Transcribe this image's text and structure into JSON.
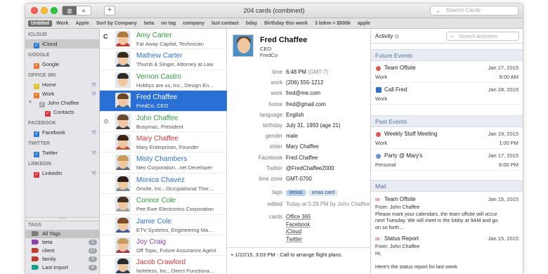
{
  "toolbar": {
    "title": "204 cards (combined)",
    "add_label": "+",
    "search_placeholder": "Search Cards"
  },
  "tagbar": [
    "Untitled",
    "Work",
    "Apple",
    "Sort by Company",
    "beta",
    "no tag",
    "company",
    "last contact",
    "bday",
    "Birthday this week",
    "3 bdrm < $500k",
    "apple"
  ],
  "sidebar": {
    "groups": [
      {
        "header": "ICLOUD",
        "items": [
          {
            "label": "iCloud",
            "color": "#2e7bd6",
            "selected": true
          }
        ]
      },
      {
        "header": "GOOGLE",
        "items": [
          {
            "label": "Google",
            "color": "#e9762b"
          }
        ]
      },
      {
        "header": "OFFICE 365",
        "items": [
          {
            "label": "Home",
            "color": "#e0c02a"
          },
          {
            "label": "Work",
            "color": "#e9762b"
          },
          {
            "label": "John Chaffee",
            "color": "#aaaaaa"
          },
          {
            "label": "Contacts",
            "color": "#d8353b"
          }
        ]
      },
      {
        "header": "FACEBOOK",
        "items": [
          {
            "label": "Facebook",
            "color": "#2e7bd6"
          }
        ]
      },
      {
        "header": "TWITTER",
        "items": [
          {
            "label": "Twitter",
            "color": "#2e7bd6"
          }
        ]
      },
      {
        "header": "LINKEDIN",
        "items": [
          {
            "label": "LinkedIn",
            "color": "#d8353b"
          }
        ]
      }
    ],
    "tags_header": "TAGS",
    "tags": [
      {
        "label": "All Tags",
        "color": "#7a7a7a",
        "count": ""
      },
      {
        "label": "beta",
        "color": "#8e44ad",
        "count": "1"
      },
      {
        "label": "client",
        "color": "#c0392b",
        "count": "17"
      },
      {
        "label": "family",
        "color": "#c0392b",
        "count": "1"
      },
      {
        "label": "Last import",
        "color": "#16a085",
        "count": "4"
      }
    ]
  },
  "contacts": {
    "section_letter": "C",
    "rows": [
      {
        "name": "Amy Carter",
        "sub": "Far Away Capital, Technician",
        "name_color": "#2f9a3d",
        "hair": "#b07a3a",
        "shirt": "#c0392b"
      },
      {
        "name": "Mathew Carter",
        "sub": "Thumb & Singer, Attorney at Law",
        "name_color": "#2f6fd0",
        "hair": "#3a2a1e",
        "shirt": "#34495e"
      },
      {
        "name": "Vernon Castro",
        "sub": "Hobbys are us, Inc., Design En…",
        "name_color": "#2f9a3d",
        "hair": "#2b2b2b",
        "shirt": "#e7e7e7"
      },
      {
        "name": "Fred Chaffee",
        "sub": "FredCo, CEO",
        "name_color": "#ffffff",
        "hair": "#6a4627",
        "shirt": "#3d6ea8"
      },
      {
        "name": "John Chaffee",
        "sub": "Busymac, President",
        "name_color": "#2f9a3d",
        "hair": "#6e4a2c",
        "shirt": "#444444"
      },
      {
        "name": "Mary Chaffee",
        "sub": "Mary Enterprises, Founder",
        "name_color": "#d8353b",
        "hair": "#3a2417",
        "shirt": "#c05a3a"
      },
      {
        "name": "Misty Chambers",
        "sub": "Neo Corporation, .net Developer",
        "name_color": "#2f6fd0",
        "hair": "#c89b58",
        "shirt": "#5d6d7e"
      },
      {
        "name": "Monica Chavez",
        "sub": "Onsite, Inc., Occupational Ther…",
        "name_color": "#2f6fd0",
        "hair": "#2b1c14",
        "shirt": "#7f8c8d"
      },
      {
        "name": "Connor Cole",
        "sub": "Pee Ewe Electronics Corporation",
        "name_color": "#2f9a3d",
        "hair": "#4a3220",
        "shirt": "#9aa1a8"
      },
      {
        "name": "Jamie Cole",
        "sub": "ETV Systems, Engineering Ma…",
        "name_color": "#2f6fd0",
        "hair": "#7d4b24",
        "shirt": "#3b5998"
      },
      {
        "name": "Joy Craig",
        "sub": "Off Topic, Future Assurance Agent",
        "name_color": "#8e44ad",
        "hair": "#c99c5e",
        "shirt": "#a04050"
      },
      {
        "name": "Jacob Crawford",
        "sub": "Noteless, Inc., Direct Functiona…",
        "name_color": "#d8353b",
        "hair": "#2b2b2b",
        "shirt": "#2c3e50"
      }
    ]
  },
  "detail": {
    "name": "Fred Chaffee",
    "title": "CEO",
    "company": "FredCo",
    "fields": [
      {
        "key": "time",
        "value": "6:48 PM",
        "muted": "(GMT-7)"
      },
      {
        "key": "work",
        "value": "(206) 555-1212"
      },
      {
        "key": "work",
        "value": "fred@me.com"
      },
      {
        "key": "home",
        "value": "fred@gmail.com"
      },
      {
        "key": "language",
        "value": "English"
      },
      {
        "key": "birthday",
        "value": "July 31, 1993 (age 21)"
      },
      {
        "key": "gender",
        "value": "male"
      },
      {
        "key": "sister",
        "value": "Mary Chaffee"
      },
      {
        "key": "Facebook",
        "value": "Fred Chaffee"
      },
      {
        "key": "Twitter",
        "value": "@FredChaffee2000"
      },
      {
        "key": "time zone",
        "value": "GMT-0700"
      }
    ],
    "tags_label": "tags",
    "tags": [
      "tennis",
      "xmas card"
    ],
    "edited_label": "edited",
    "edited_value": "Today at 5:28 PM by John Chaffee",
    "cards_label": "cards",
    "cards": [
      "Office 365",
      "Facebook",
      "iCloud",
      "Twitter"
    ],
    "note": "+ 1/22/15, 3:03 PM - Call to arrange flight plans."
  },
  "activity": {
    "title": "Activity ◇",
    "search_placeholder": "Search Activities",
    "future_header": "Future Events",
    "past_header": "Past Events",
    "mail_header": "Mail",
    "future": [
      {
        "title": "Team Offsite",
        "sub": "Work",
        "date": "Jan 27, 2015",
        "time": "9:00 AM",
        "color": "#e05a4e",
        "kind": "dot"
      },
      {
        "title": "Call Fred",
        "sub": "Work",
        "date": "Jan 28, 2015",
        "time": "",
        "color": "#2e6fd1",
        "kind": "square"
      }
    ],
    "past": [
      {
        "title": "Weekly Staff Meeting",
        "sub": "Work",
        "date": "Jan 19, 2015",
        "time": "1:00 PM",
        "color": "#e05a4e",
        "kind": "dot"
      },
      {
        "title": "Party @ Mary's",
        "sub": "Personal",
        "date": "Jan 17, 2015",
        "time": "6:00 PM",
        "color": "#6c8fd6",
        "kind": "dot"
      }
    ],
    "mail": [
      {
        "subject": "Team Offsite",
        "date": "Jan 15, 2015",
        "lines": [
          "From: John Chaffee",
          "Please mark your calendars, the team offsite will occur",
          "next Tuesday. We will meet in the lobby at 9AM and go",
          "on so forth…"
        ]
      },
      {
        "subject": "Status Report",
        "date": "Jan 15, 2015",
        "lines": [
          "From: John Chaffee",
          "Hi,",
          "",
          "Here's the status report for last week"
        ]
      }
    ]
  }
}
